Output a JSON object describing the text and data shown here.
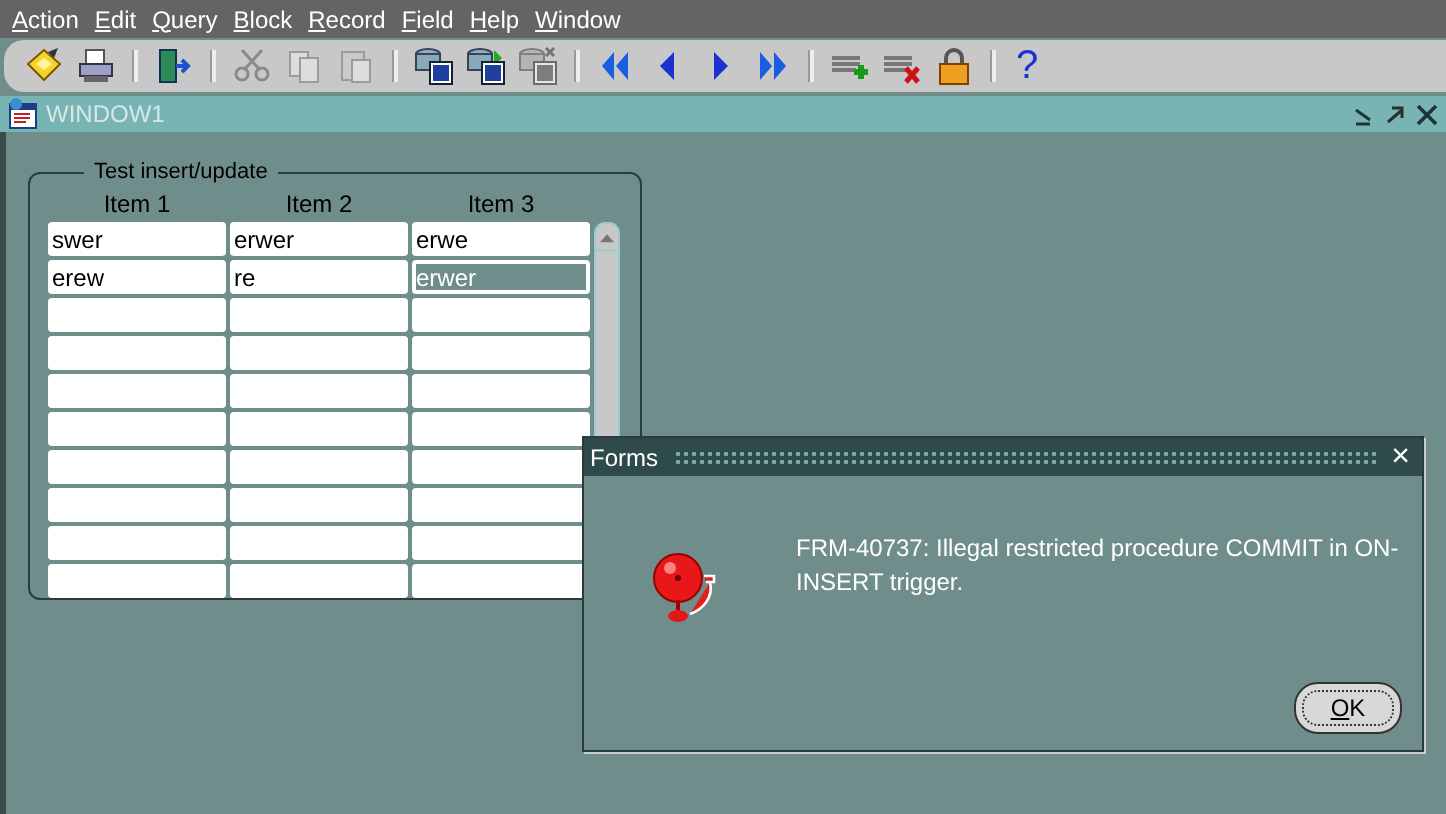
{
  "menu": [
    "Action",
    "Edit",
    "Query",
    "Block",
    "Record",
    "Field",
    "Help",
    "Window"
  ],
  "toolbar": [
    {
      "kind": "button",
      "disabled": false
    },
    {
      "kind": "button",
      "disabled": false
    },
    {
      "kind": "separator"
    },
    {
      "kind": "button",
      "disabled": false
    },
    {
      "kind": "separator"
    },
    {
      "kind": "button",
      "disabled": true
    },
    {
      "kind": "button",
      "disabled": true
    },
    {
      "kind": "button",
      "disabled": true
    },
    {
      "kind": "separator"
    },
    {
      "kind": "button",
      "disabled": false
    },
    {
      "kind": "button",
      "disabled": false
    },
    {
      "kind": "button",
      "disabled": true
    },
    {
      "kind": "separator"
    },
    {
      "kind": "button",
      "disabled": false
    },
    {
      "kind": "button",
      "disabled": false
    },
    {
      "kind": "button",
      "disabled": false
    },
    {
      "kind": "button",
      "disabled": false
    },
    {
      "kind": "separator"
    },
    {
      "kind": "button",
      "disabled": false
    },
    {
      "kind": "button",
      "disabled": false
    },
    {
      "kind": "button",
      "disabled": false
    },
    {
      "kind": "separator"
    },
    {
      "kind": "glyph",
      "text": "?",
      "disabled": false
    }
  ],
  "window": {
    "title": "WINDOW1"
  },
  "frame": {
    "title": "Test insert/update",
    "columns": [
      "Item 1",
      "Item 2",
      "Item 3"
    ],
    "rows": [
      {
        "cells": [
          {
            "kind": "text",
            "value": "swer",
            "highlighted": false
          },
          {
            "kind": "text",
            "value": "erwer",
            "highlighted": false
          },
          {
            "kind": "text",
            "value": "erwe",
            "highlighted": false
          }
        ]
      },
      {
        "cells": [
          {
            "kind": "text",
            "value": "erew",
            "highlighted": false
          },
          {
            "kind": "text",
            "value": "re",
            "highlighted": false
          },
          {
            "kind": "text",
            "value": "erwer",
            "highlighted": true
          }
        ]
      },
      {
        "cells": [
          {
            "kind": "empty"
          },
          {
            "kind": "empty"
          },
          {
            "kind": "empty"
          }
        ]
      },
      {
        "cells": [
          {
            "kind": "empty"
          },
          {
            "kind": "empty"
          },
          {
            "kind": "empty"
          }
        ]
      },
      {
        "cells": [
          {
            "kind": "empty"
          },
          {
            "kind": "empty"
          },
          {
            "kind": "empty"
          }
        ]
      },
      {
        "cells": [
          {
            "kind": "empty"
          },
          {
            "kind": "empty"
          },
          {
            "kind": "empty"
          }
        ]
      },
      {
        "cells": [
          {
            "kind": "empty"
          },
          {
            "kind": "empty"
          },
          {
            "kind": "empty"
          }
        ]
      },
      {
        "cells": [
          {
            "kind": "empty"
          },
          {
            "kind": "empty"
          },
          {
            "kind": "empty"
          }
        ]
      },
      {
        "cells": [
          {
            "kind": "empty"
          },
          {
            "kind": "empty"
          },
          {
            "kind": "empty"
          }
        ]
      },
      {
        "cells": [
          {
            "kind": "empty"
          },
          {
            "kind": "empty"
          },
          {
            "kind": "empty"
          }
        ]
      }
    ]
  },
  "dialog": {
    "title": "Forms",
    "close": "×",
    "message": "FRM-40737: Illegal restricted procedure COMMIT in ON-INSERT trigger.",
    "button": "OK"
  }
}
